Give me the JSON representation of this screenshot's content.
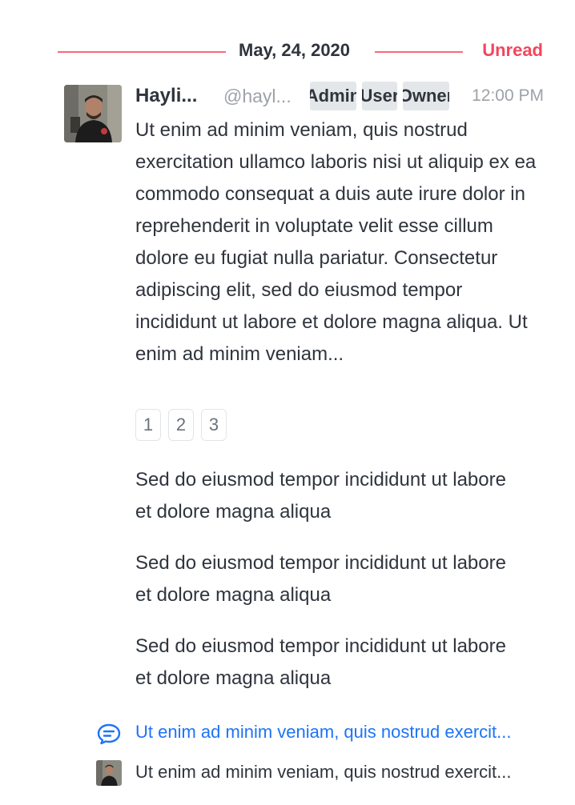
{
  "divider": {
    "date": "May, 24, 2020",
    "unread_label": "Unread",
    "accent_color": "#f5455c"
  },
  "message": {
    "author_name": "Hayli...",
    "username": "@hayl...",
    "roles": [
      "Admin",
      "User",
      "Owner"
    ],
    "time": "12:00 PM",
    "body": "Ut enim ad minim veniam, quis nostrud exercitation ullamco laboris nisi ut aliquip ex ea commodo consequat a duis aute irure dolor in reprehenderit in voluptate velit esse cillum dolore eu fugiat nulla pariatur. Consectetur adipiscing elit, sed do eiusmod tempor incididunt ut labore et dolore magna aliqua. Ut enim ad minim veniam...",
    "reactions": [
      "1",
      "2",
      "3"
    ],
    "paragraphs": [
      "Sed do eiusmod tempor incididunt ut labore et dolore magna aliqua",
      "Sed do eiusmod tempor incididunt ut labore et dolore magna aliqua",
      "Sed do eiusmod tempor incididunt ut labore et dolore magna aliqua"
    ],
    "avatar_icon": "user-photo-icon"
  },
  "thread": {
    "icon": "thread-reply-icon",
    "link_text": "Ut enim ad minim veniam, quis nostrud exercit...",
    "link_color": "#1d74f5"
  },
  "reply_preview": {
    "text": "Ut enim ad minim veniam, quis nostrud exercit..."
  }
}
